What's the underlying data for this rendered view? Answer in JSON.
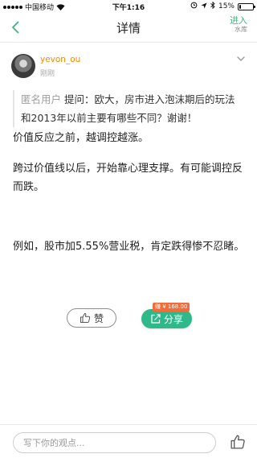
{
  "status_bar": {
    "carrier": "中国移动",
    "time": "下午1:16",
    "battery": "15%",
    "battery_level": 0.15
  },
  "nav": {
    "title": "详情",
    "right_main": "进入",
    "right_sub": "水库"
  },
  "author": {
    "name": "yevon_ou",
    "subtitle": "刚刚"
  },
  "question": {
    "asker": "匿名用户",
    "text": " 提问：欧大，房市进入泡沫期后的玩法和2013年以前主要有哪些不同？谢谢！"
  },
  "answer": {
    "paragraphs": [
      "价值反应之前，越调控越涨。",
      "跨过价值线以后，开始靠心理支撑。有可能调控反而跌。",
      "例如，股市加5.55%营业税，肯定跌得惨不忍睹。"
    ]
  },
  "actions": {
    "like_label": "赞",
    "reward_label": "赚 ¥ 168.00",
    "share_label": "分享"
  },
  "bottom_bar": {
    "comment_placeholder": "写下你的观点..."
  },
  "colors": {
    "accent_green": "#2fb98b",
    "author_orange": "#f08a00",
    "reward_red": "#f26c3a"
  }
}
